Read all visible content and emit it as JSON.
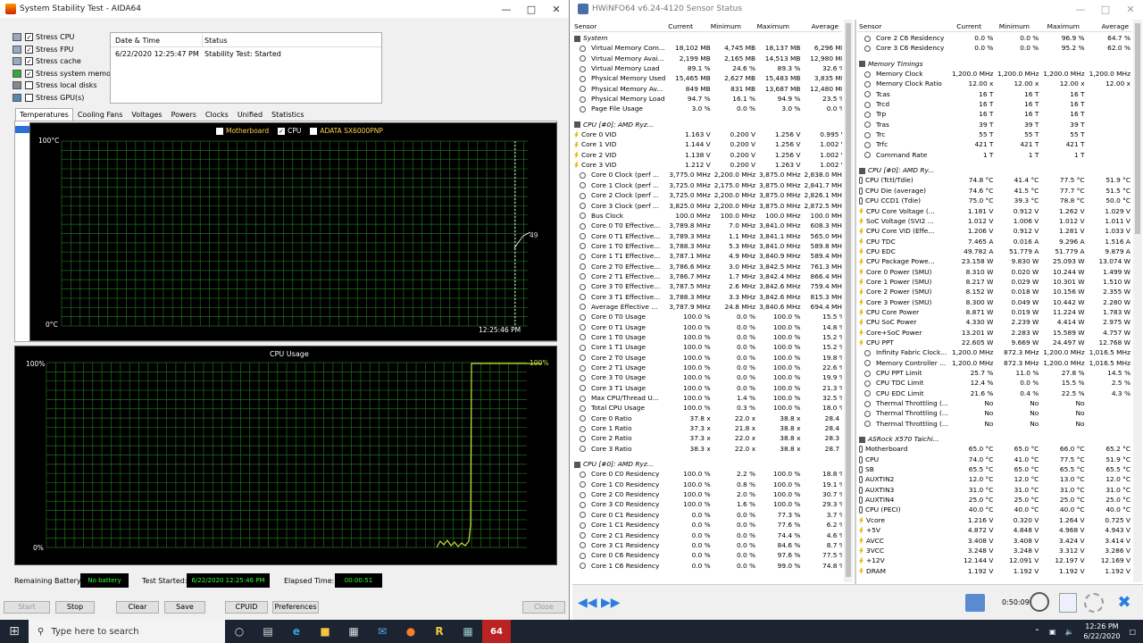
{
  "aida": {
    "title": "System Stability Test - AIDA64",
    "checks": [
      "Stress CPU",
      "Stress FPU",
      "Stress cache",
      "Stress system memory",
      "Stress local disks",
      "Stress GPU(s)"
    ],
    "checked": [
      true,
      true,
      true,
      true,
      false,
      false
    ],
    "status_header_date": "Date & Time",
    "status_header_status": "Status",
    "status_date": "6/22/2020 12:25:47 PM",
    "status_text": "Stability Test: Started",
    "tabs": [
      "Temperatures",
      "Cooling Fans",
      "Voltages",
      "Powers",
      "Clocks",
      "Unified",
      "Statistics"
    ],
    "legend": [
      "Motherboard",
      "CPU",
      "ADATA SX6000PNP"
    ],
    "legend_checked": [
      false,
      true,
      false
    ],
    "temp_top": "100°C",
    "temp_bottom": "0°C",
    "temp_value": "49",
    "temp_time": "12:25:46 PM",
    "usage_title": "CPU Usage",
    "usage_top": "100%",
    "usage_bottom": "0%",
    "usage_value": "100%",
    "battery_label": "Remaining Battery:",
    "battery_value": "No battery",
    "started_label": "Test Started:",
    "started_value": "6/22/2020 12:25:46 PM",
    "elapsed_label": "Elapsed Time:",
    "elapsed_value": "00:00:51",
    "buttons": {
      "start": "Start",
      "stop": "Stop",
      "clear": "Clear",
      "save": "Save",
      "cpuid": "CPUID",
      "preferences": "Preferences",
      "close": "Close"
    },
    "colors": {
      "graph_line": "#c8e040",
      "grid": "#1e6e1e",
      "status_green": "#33ff33"
    }
  },
  "hw": {
    "title": "HWiNFO64 v6.24-4120 Sensor Status",
    "headers": [
      "Sensor",
      "Current",
      "Minimum",
      "Maximum",
      "Average"
    ],
    "left_rows": [
      [
        "sec",
        "System",
        "",
        "",
        "",
        ""
      ],
      [
        "c",
        "Virtual Memory Com...",
        "18,102 MB",
        "4,745 MB",
        "18,137 MB",
        "6,296 MB"
      ],
      [
        "c",
        "Virtual Memory Avai...",
        "2,199 MB",
        "2,165 MB",
        "14,513 MB",
        "12,980 MB"
      ],
      [
        "c",
        "Virtual Memory Load",
        "89.1 %",
        "24.6 %",
        "89.3 %",
        "32.6 %"
      ],
      [
        "c",
        "Physical Memory Used",
        "15,465 MB",
        "2,627 MB",
        "15,483 MB",
        "3,835 MB"
      ],
      [
        "c",
        "Physical Memory Av...",
        "849 MB",
        "831 MB",
        "13,687 MB",
        "12,480 MB"
      ],
      [
        "c",
        "Physical Memory Load",
        "94.7 %",
        "16.1 %",
        "94.9 %",
        "23.5 %"
      ],
      [
        "c",
        "Page File Usage",
        "3.0 %",
        "0.0 %",
        "3.0 %",
        "0.0 %"
      ],
      [
        "blank",
        "",
        "",
        "",
        "",
        ""
      ],
      [
        "sec",
        "CPU [#0]: AMD Ryz...",
        "",
        "",
        "",
        ""
      ],
      [
        "b",
        "Core 0 VID",
        "1.163 V",
        "0.200 V",
        "1.256 V",
        "0.995 V"
      ],
      [
        "b",
        "Core 1 VID",
        "1.144 V",
        "0.200 V",
        "1.256 V",
        "1.002 V"
      ],
      [
        "b",
        "Core 2 VID",
        "1.138 V",
        "0.200 V",
        "1.256 V",
        "1.002 V"
      ],
      [
        "b",
        "Core 3 VID",
        "1.212 V",
        "0.200 V",
        "1.263 V",
        "1.002 V"
      ],
      [
        "c",
        "Core 0 Clock (perf ...",
        "3,775.0 MHz",
        "2,200.0 MHz",
        "3,875.0 MHz",
        "2,838.0 MHz"
      ],
      [
        "c",
        "Core 1 Clock (perf ...",
        "3,725.0 MHz",
        "2,175.0 MHz",
        "3,875.0 MHz",
        "2,841.7 MHz"
      ],
      [
        "c",
        "Core 2 Clock (perf ...",
        "3,725.0 MHz",
        "2,200.0 MHz",
        "3,875.0 MHz",
        "2,826.1 MHz"
      ],
      [
        "c",
        "Core 3 Clock (perf ...",
        "3,825.0 MHz",
        "2,200.0 MHz",
        "3,875.0 MHz",
        "2,872.5 MHz"
      ],
      [
        "c",
        "Bus Clock",
        "100.0 MHz",
        "100.0 MHz",
        "100.0 MHz",
        "100.0 MHz"
      ],
      [
        "c",
        "Core 0 T0 Effective...",
        "3,789.8 MHz",
        "7.0 MHz",
        "3,841.0 MHz",
        "608.3 MHz"
      ],
      [
        "c",
        "Core 0 T1 Effective...",
        "3,789.3 MHz",
        "1.1 MHz",
        "3,841.1 MHz",
        "565.0 MHz"
      ],
      [
        "c",
        "Core 1 T0 Effective...",
        "3,788.3 MHz",
        "5.3 MHz",
        "3,841.0 MHz",
        "589.8 MHz"
      ],
      [
        "c",
        "Core 1 T1 Effective...",
        "3,787.1 MHz",
        "4.9 MHz",
        "3,840.9 MHz",
        "589.4 MHz"
      ],
      [
        "c",
        "Core 2 T0 Effective...",
        "3,786.6 MHz",
        "3.0 MHz",
        "3,842.5 MHz",
        "761.3 MHz"
      ],
      [
        "c",
        "Core 2 T1 Effective...",
        "3,786.7 MHz",
        "1.7 MHz",
        "3,842.4 MHz",
        "866.4 MHz"
      ],
      [
        "c",
        "Core 3 T0 Effective...",
        "3,787.5 MHz",
        "2.6 MHz",
        "3,842.6 MHz",
        "759.4 MHz"
      ],
      [
        "c",
        "Core 3 T1 Effective...",
        "3,788.3 MHz",
        "3.3 MHz",
        "3,842.6 MHz",
        "815.3 MHz"
      ],
      [
        "c",
        "Average Effective ...",
        "3,787.9 MHz",
        "24.8 MHz",
        "3,840.6 MHz",
        "694.4 MHz"
      ],
      [
        "c",
        "Core 0 T0 Usage",
        "100.0 %",
        "0.0 %",
        "100.0 %",
        "15.5 %"
      ],
      [
        "c",
        "Core 0 T1 Usage",
        "100.0 %",
        "0.0 %",
        "100.0 %",
        "14.8 %"
      ],
      [
        "c",
        "Core 1 T0 Usage",
        "100.0 %",
        "0.0 %",
        "100.0 %",
        "15.2 %"
      ],
      [
        "c",
        "Core 1 T1 Usage",
        "100.0 %",
        "0.0 %",
        "100.0 %",
        "15.2 %"
      ],
      [
        "c",
        "Core 2 T0 Usage",
        "100.0 %",
        "0.0 %",
        "100.0 %",
        "19.8 %"
      ],
      [
        "c",
        "Core 2 T1 Usage",
        "100.0 %",
        "0.0 %",
        "100.0 %",
        "22.6 %"
      ],
      [
        "c",
        "Core 3 T0 Usage",
        "100.0 %",
        "0.0 %",
        "100.0 %",
        "19.9 %"
      ],
      [
        "c",
        "Core 3 T1 Usage",
        "100.0 %",
        "0.0 %",
        "100.0 %",
        "21.3 %"
      ],
      [
        "c",
        "Max CPU/Thread U...",
        "100.0 %",
        "1.4 %",
        "100.0 %",
        "32.5 %"
      ],
      [
        "c",
        "Total CPU Usage",
        "100.0 %",
        "0.3 %",
        "100.0 %",
        "18.0 %"
      ],
      [
        "c",
        "Core 0 Ratio",
        "37.8 x",
        "22.0 x",
        "38.8 x",
        "28.4 x"
      ],
      [
        "c",
        "Core 1 Ratio",
        "37.3 x",
        "21.8 x",
        "38.8 x",
        "28.4 x"
      ],
      [
        "c",
        "Core 2 Ratio",
        "37.3 x",
        "22.0 x",
        "38.8 x",
        "28.3 x"
      ],
      [
        "c",
        "Core 3 Ratio",
        "38.3 x",
        "22.0 x",
        "38.8 x",
        "28.7 x"
      ],
      [
        "blank",
        "",
        "",
        "",
        "",
        ""
      ],
      [
        "sec",
        "CPU [#0]: AMD Ryz...",
        "",
        "",
        "",
        ""
      ],
      [
        "c",
        "Core 0 C0 Residency",
        "100.0 %",
        "2.2 %",
        "100.0 %",
        "18.8 %"
      ],
      [
        "c",
        "Core 1 C0 Residency",
        "100.0 %",
        "0.8 %",
        "100.0 %",
        "19.1 %"
      ],
      [
        "c",
        "Core 2 C0 Residency",
        "100.0 %",
        "2.0 %",
        "100.0 %",
        "30.7 %"
      ],
      [
        "c",
        "Core 3 C0 Residency",
        "100.0 %",
        "1.6 %",
        "100.0 %",
        "29.3 %"
      ],
      [
        "c",
        "Core 0 C1 Residency",
        "0.0 %",
        "0.0 %",
        "77.3 %",
        "3.7 %"
      ],
      [
        "c",
        "Core 1 C1 Residency",
        "0.0 %",
        "0.0 %",
        "77.6 %",
        "6.2 %"
      ],
      [
        "c",
        "Core 2 C1 Residency",
        "0.0 %",
        "0.0 %",
        "74.4 %",
        "4.6 %"
      ],
      [
        "c",
        "Core 3 C1 Residency",
        "0.0 %",
        "0.0 %",
        "84.6 %",
        "8.7 %"
      ],
      [
        "c",
        "Core 0 C6 Residency",
        "0.0 %",
        "0.0 %",
        "97.6 %",
        "77.5 %"
      ],
      [
        "c",
        "Core 1 C6 Residency",
        "0.0 %",
        "0.0 %",
        "99.0 %",
        "74.8 %"
      ]
    ],
    "right_rows": [
      [
        "c",
        "Core 2 C6 Residency",
        "0.0 %",
        "0.0 %",
        "96.9 %",
        "64.7 %"
      ],
      [
        "c",
        "Core 3 C6 Residency",
        "0.0 %",
        "0.0 %",
        "95.2 %",
        "62.0 %"
      ],
      [
        "blank",
        "",
        "",
        "",
        "",
        ""
      ],
      [
        "sec",
        "Memory Timings",
        "",
        "",
        "",
        ""
      ],
      [
        "c",
        "Memory Clock",
        "1,200.0 MHz",
        "1,200.0 MHz",
        "1,200.0 MHz",
        "1,200.0 MHz"
      ],
      [
        "c",
        "Memory Clock Ratio",
        "12.00 x",
        "12.00 x",
        "12.00 x",
        "12.00 x"
      ],
      [
        "c",
        "Tcas",
        "16 T",
        "16 T",
        "16 T",
        ""
      ],
      [
        "c",
        "Trcd",
        "16 T",
        "16 T",
        "16 T",
        ""
      ],
      [
        "c",
        "Trp",
        "16 T",
        "16 T",
        "16 T",
        ""
      ],
      [
        "c",
        "Tras",
        "39 T",
        "39 T",
        "39 T",
        ""
      ],
      [
        "c",
        "Trc",
        "55 T",
        "55 T",
        "55 T",
        ""
      ],
      [
        "c",
        "Trfc",
        "421 T",
        "421 T",
        "421 T",
        ""
      ],
      [
        "c",
        "Command Rate",
        "1 T",
        "1 T",
        "1 T",
        ""
      ],
      [
        "blank",
        "",
        "",
        "",
        "",
        ""
      ],
      [
        "sec",
        "CPU [#0]: AMD Ry...",
        "",
        "",
        "",
        ""
      ],
      [
        "t",
        "CPU (Tctl/Tdie)",
        "74.8 °C",
        "41.4 °C",
        "77.5 °C",
        "51.9 °C"
      ],
      [
        "t",
        "CPU Die (average)",
        "74.6 °C",
        "41.5 °C",
        "77.7 °C",
        "51.5 °C"
      ],
      [
        "t",
        "CPU CCD1 (Tdie)",
        "75.0 °C",
        "39.3 °C",
        "78.8 °C",
        "50.0 °C"
      ],
      [
        "b",
        "CPU Core Voltage (...",
        "1.181 V",
        "0.912 V",
        "1.262 V",
        "1.029 V"
      ],
      [
        "b",
        "SoC Voltage (SVI2 ...",
        "1.012 V",
        "1.006 V",
        "1.012 V",
        "1.011 V"
      ],
      [
        "b",
        "CPU Core VID (Effe...",
        "1.206 V",
        "0.912 V",
        "1.281 V",
        "1.033 V"
      ],
      [
        "b",
        "CPU TDC",
        "7.465 A",
        "0.016 A",
        "9.296 A",
        "1.516 A"
      ],
      [
        "b",
        "CPU EDC",
        "49.782 A",
        "51.779 A",
        "51.779 A",
        "9.879 A"
      ],
      [
        "b",
        "CPU Package Powe...",
        "23.158 W",
        "9.830 W",
        "25.093 W",
        "13.074 W"
      ],
      [
        "b",
        "Core 0 Power (SMU)",
        "8.310 W",
        "0.020 W",
        "10.244 W",
        "1.499 W"
      ],
      [
        "b",
        "Core 1 Power (SMU)",
        "8.217 W",
        "0.029 W",
        "10.301 W",
        "1.510 W"
      ],
      [
        "b",
        "Core 2 Power (SMU)",
        "8.152 W",
        "0.018 W",
        "10.156 W",
        "2.355 W"
      ],
      [
        "b",
        "Core 3 Power (SMU)",
        "8.300 W",
        "0.049 W",
        "10.442 W",
        "2.280 W"
      ],
      [
        "b",
        "CPU Core Power",
        "8.871 W",
        "0.019 W",
        "11.224 W",
        "1.783 W"
      ],
      [
        "b",
        "CPU SoC Power",
        "4.330 W",
        "2.239 W",
        "4.414 W",
        "2.975 W"
      ],
      [
        "b",
        "Core+SoC Power",
        "13.201 W",
        "2.283 W",
        "15.589 W",
        "4.757 W"
      ],
      [
        "b",
        "CPU PPT",
        "22.605 W",
        "9.669 W",
        "24.497 W",
        "12.768 W"
      ],
      [
        "c",
        "Infinity Fabric Clock...",
        "1,200.0 MHz",
        "872.3 MHz",
        "1,200.0 MHz",
        "1,016.5 MHz"
      ],
      [
        "c",
        "Memory Controller ...",
        "1,200.0 MHz",
        "872.3 MHz",
        "1,200.0 MHz",
        "1,016.5 MHz"
      ],
      [
        "c",
        "CPU PPT Limit",
        "25.7 %",
        "11.0 %",
        "27.8 %",
        "14.5 %"
      ],
      [
        "c",
        "CPU TDC Limit",
        "12.4 %",
        "0.0 %",
        "15.5 %",
        "2.5 %"
      ],
      [
        "c",
        "CPU EDC Limit",
        "21.6 %",
        "0.4 %",
        "22.5 %",
        "4.3 %"
      ],
      [
        "c",
        "Thermal Throttling (...",
        "No",
        "No",
        "No",
        ""
      ],
      [
        "c",
        "Thermal Throttling (...",
        "No",
        "No",
        "No",
        ""
      ],
      [
        "c",
        "Thermal Throttling (...",
        "No",
        "No",
        "No",
        ""
      ],
      [
        "blank",
        "",
        "",
        "",
        "",
        ""
      ],
      [
        "sec",
        "ASRock X570 Taichi...",
        "",
        "",
        "",
        ""
      ],
      [
        "t",
        "Motherboard",
        "65.0 °C",
        "65.0 °C",
        "66.0 °C",
        "65.2 °C"
      ],
      [
        "t",
        "CPU",
        "74.0 °C",
        "41.0 °C",
        "77.5 °C",
        "51.9 °C"
      ],
      [
        "t",
        "SB",
        "65.5 °C",
        "65.0 °C",
        "65.5 °C",
        "65.5 °C"
      ],
      [
        "t",
        "AUXTIN2",
        "12.0 °C",
        "12.0 °C",
        "13.0 °C",
        "12.0 °C"
      ],
      [
        "t",
        "AUXTIN3",
        "31.0 °C",
        "31.0 °C",
        "31.0 °C",
        "31.0 °C"
      ],
      [
        "t",
        "AUXTIN4",
        "25.0 °C",
        "25.0 °C",
        "25.0 °C",
        "25.0 °C"
      ],
      [
        "t",
        "CPU (PECI)",
        "40.0 °C",
        "40.0 °C",
        "40.0 °C",
        "40.0 °C"
      ],
      [
        "b",
        "Vcore",
        "1.216 V",
        "0.320 V",
        "1.264 V",
        "0.725 V"
      ],
      [
        "b",
        "+5V",
        "4.872 V",
        "4.848 V",
        "4.968 V",
        "4.943 V"
      ],
      [
        "b",
        "AVCC",
        "3.408 V",
        "3.408 V",
        "3.424 V",
        "3.414 V"
      ],
      [
        "b",
        "3VCC",
        "3.248 V",
        "3.248 V",
        "3.312 V",
        "3.286 V"
      ],
      [
        "b",
        "+12V",
        "12.144 V",
        "12.091 V",
        "12.197 V",
        "12.169 V"
      ],
      [
        "b",
        "DRAM",
        "1.192 V",
        "1.192 V",
        "1.192 V",
        "1.192 V"
      ]
    ],
    "timer": "0:50:09"
  },
  "taskbar": {
    "search_placeholder": "Type here to search",
    "time": "12:26 PM",
    "date": "6/22/2020"
  }
}
